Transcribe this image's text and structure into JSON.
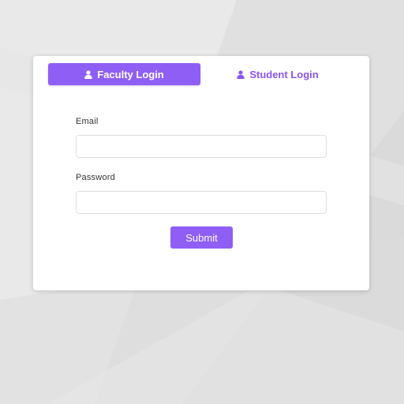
{
  "tabs": {
    "faculty_label": "Faculty Login",
    "student_label": "Student Login",
    "active": "faculty",
    "icon": "user-icon"
  },
  "form": {
    "email_label": "Email",
    "email_value": "",
    "password_label": "Password",
    "password_value": "",
    "submit_label": "Submit"
  },
  "colors": {
    "accent": "#8f5ef5",
    "accent_text": "#8a55ef",
    "background": "#e4e4e4",
    "card": "#ffffff"
  }
}
